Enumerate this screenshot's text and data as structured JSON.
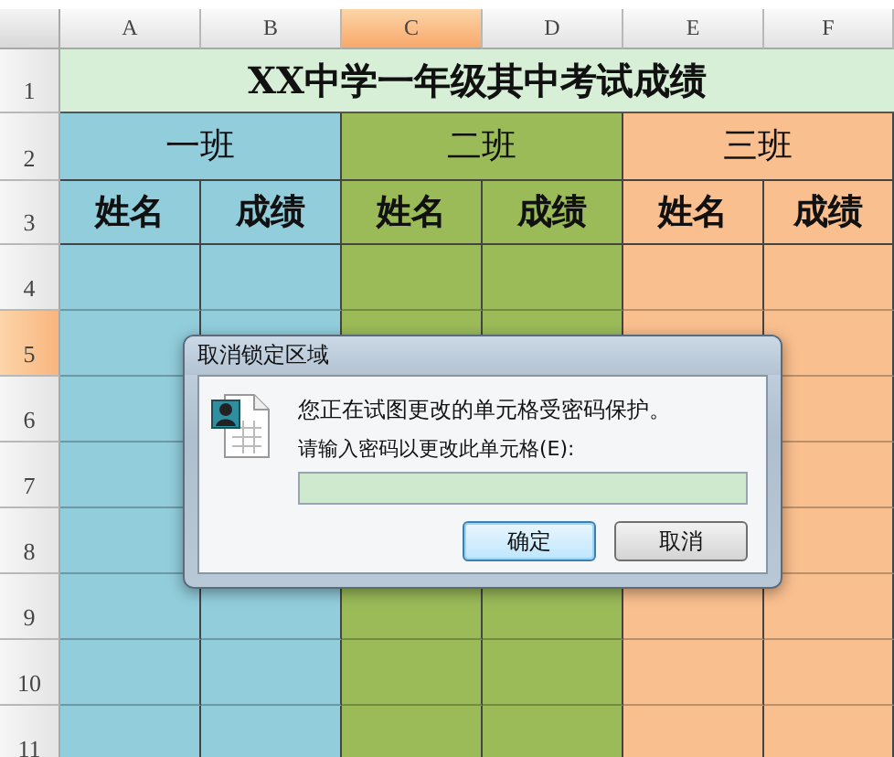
{
  "columns": [
    {
      "label": "A",
      "selected": false
    },
    {
      "label": "B",
      "selected": false
    },
    {
      "label": "C",
      "selected": true
    },
    {
      "label": "D",
      "selected": false
    },
    {
      "label": "E",
      "selected": false
    },
    {
      "label": "F",
      "selected": false
    }
  ],
  "rows": [
    {
      "label": "1",
      "selected": false
    },
    {
      "label": "2",
      "selected": false
    },
    {
      "label": "3",
      "selected": false
    },
    {
      "label": "4",
      "selected": false
    },
    {
      "label": "5",
      "selected": true
    },
    {
      "label": "6",
      "selected": false
    },
    {
      "label": "7",
      "selected": false
    },
    {
      "label": "8",
      "selected": false
    },
    {
      "label": "9",
      "selected": false
    },
    {
      "label": "10",
      "selected": false
    },
    {
      "label": "11",
      "selected": false
    }
  ],
  "title": "XX中学一年级其中考试成绩",
  "classes": [
    {
      "name": "一班",
      "color": "#92cddc",
      "fields": [
        "姓名",
        "成绩"
      ]
    },
    {
      "name": "二班",
      "color": "#9bbb59",
      "fields": [
        "姓名",
        "成绩"
      ]
    },
    {
      "name": "三班",
      "color": "#fabf8f",
      "fields": [
        "姓名",
        "成绩"
      ]
    }
  ],
  "dialog": {
    "title": "取消锁定区域",
    "message": "您正在试图更改的单元格受密码保护。",
    "prompt": "请输入密码以更改此单元格(E):",
    "buttons": [
      {
        "label": "确定",
        "default": true
      },
      {
        "label": "取消",
        "default": false
      }
    ]
  }
}
